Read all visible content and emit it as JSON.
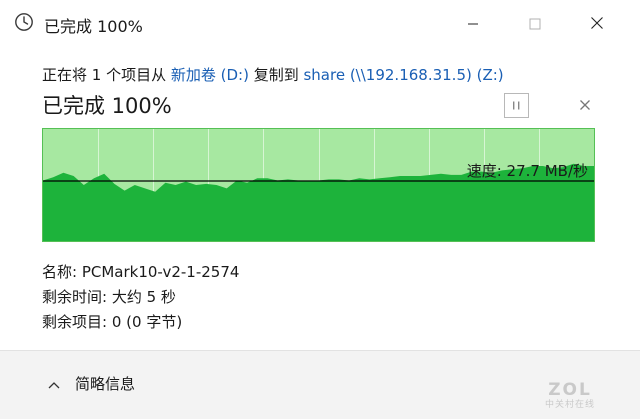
{
  "window": {
    "title": "已完成 100%",
    "icon": "clock-icon",
    "controls": [
      "minimize-icon",
      "maximize-icon",
      "close-icon"
    ]
  },
  "copy": {
    "prefix": "正在将 1 个项目从 ",
    "source": "新加卷 (D:)",
    "middle": " 复制到 ",
    "destination": "share (\\\\192.168.31.5) (Z:)"
  },
  "progress": {
    "heading": "已完成 100%",
    "percent": 100,
    "pause_icon": "pause-icon",
    "cancel_icon": "close-icon"
  },
  "graph": {
    "speed_text": "速度: 27.7 MB/秒",
    "speed_mb_per_s": 27.7,
    "colors": {
      "background": "#a7e8a1",
      "fill": "#1db33b",
      "border": "#55c055",
      "grid": "#ffffff",
      "line": "#000000"
    },
    "transfer_profile": [
      0.46,
      0.43,
      0.39,
      0.42,
      0.5,
      0.44,
      0.4,
      0.49,
      0.55,
      0.5,
      0.53,
      0.56,
      0.48,
      0.5,
      0.47,
      0.5,
      0.49,
      0.5,
      0.53,
      0.46,
      0.48,
      0.44,
      0.44,
      0.46,
      0.45,
      0.46,
      0.46,
      0.46,
      0.45,
      0.45,
      0.46,
      0.44,
      0.45,
      0.44,
      0.43,
      0.42,
      0.42,
      0.42,
      0.41,
      0.4,
      0.41,
      0.41,
      0.38,
      0.38,
      0.39,
      0.37,
      0.36,
      0.35,
      0.33,
      0.33,
      0.35,
      0.34,
      0.31,
      0.33,
      0.33
    ]
  },
  "details": {
    "name_label": "名称:",
    "name_value": "PCMark10-v2-1-2574",
    "time_label": "剩余时间:",
    "time_value": "大约 5 秒",
    "items_label": "剩余项目:",
    "items_value": "0 (0 字节)"
  },
  "footer": {
    "toggle_label": "简略信息",
    "toggle_icon": "chevron-up-icon"
  },
  "watermark": {
    "logo": "ZOL",
    "sub": "中关村在线"
  }
}
